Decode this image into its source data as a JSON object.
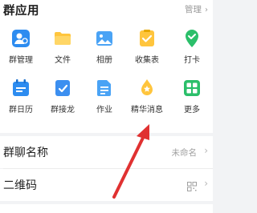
{
  "section": {
    "title": "群应用",
    "manage_label": "管理"
  },
  "apps_row1": [
    {
      "label": "群管理",
      "icon": "group-manage-icon"
    },
    {
      "label": "文件",
      "icon": "folder-icon"
    },
    {
      "label": "相册",
      "icon": "photo-album-icon"
    },
    {
      "label": "收集表",
      "icon": "collection-form-icon"
    },
    {
      "label": "打卡",
      "icon": "check-in-icon"
    }
  ],
  "apps_row2": [
    {
      "label": "群日历",
      "icon": "calendar-icon"
    },
    {
      "label": "群接龙",
      "icon": "relay-icon"
    },
    {
      "label": "作业",
      "icon": "homework-icon"
    },
    {
      "label": "精华消息",
      "icon": "essence-message-icon"
    },
    {
      "label": "更多",
      "icon": "more-icon"
    }
  ],
  "group_name": {
    "title": "群聊名称",
    "value": "未命名"
  },
  "qr_code": {
    "title": "二维码",
    "icon": "qr-code-icon"
  },
  "colors": {
    "blue": "#2d8cf0",
    "yellow": "#ffc53d",
    "green": "#2bbf6a",
    "arrow_red": "#e03131"
  }
}
